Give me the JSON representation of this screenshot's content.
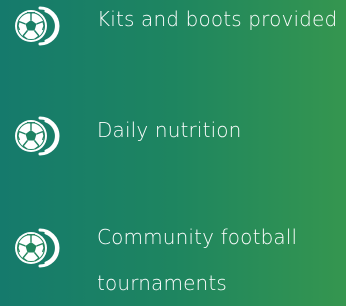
{
  "features": {
    "items": [
      {
        "label": "Kits and boots provided",
        "icon": "football-icon"
      },
      {
        "label": "Daily nutrition",
        "icon": "football-icon"
      },
      {
        "label": "Community football tournaments",
        "icon": "football-icon"
      }
    ]
  },
  "colors": {
    "background_start": "#157a6c",
    "background_end": "#35964f",
    "text": "#ffffff",
    "icon": "#ffffff"
  }
}
